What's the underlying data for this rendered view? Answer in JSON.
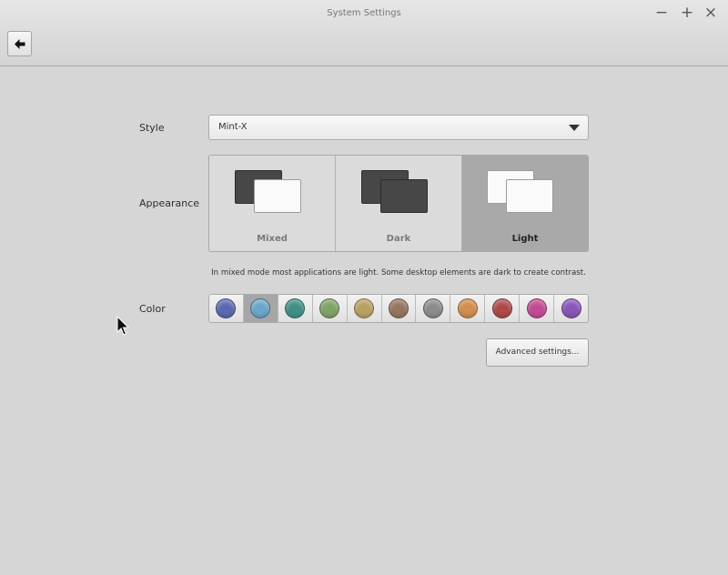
{
  "window": {
    "title": "System Settings",
    "minimize": "−",
    "maximize": "+",
    "close": "×"
  },
  "style": {
    "label": "Style",
    "value": "Mint-X"
  },
  "appearance": {
    "label": "Appearance",
    "options": [
      {
        "label": "Mixed",
        "selected": false
      },
      {
        "label": "Dark",
        "selected": false
      },
      {
        "label": "Light",
        "selected": true
      }
    ],
    "description": "In mixed mode most applications are light. Some desktop elements are dark to create contrast."
  },
  "color": {
    "label": "Color",
    "swatches": [
      {
        "name": "blue",
        "hex": "#5a68b0",
        "selected": false
      },
      {
        "name": "aqua",
        "hex": "#6aa6c8",
        "selected": true
      },
      {
        "name": "teal",
        "hex": "#3f8f85",
        "selected": false
      },
      {
        "name": "green",
        "hex": "#7fa266",
        "selected": false
      },
      {
        "name": "sand",
        "hex": "#b9a060",
        "selected": false
      },
      {
        "name": "brown",
        "hex": "#957460",
        "selected": false
      },
      {
        "name": "grey",
        "hex": "#8b8b8b",
        "selected": false
      },
      {
        "name": "orange",
        "hex": "#d08d4d",
        "selected": false
      },
      {
        "name": "red",
        "hex": "#ad4848",
        "selected": false
      },
      {
        "name": "pink",
        "hex": "#c24a92",
        "selected": false
      },
      {
        "name": "purple",
        "hex": "#8a55b7",
        "selected": false
      }
    ]
  },
  "advanced_button": "Advanced settings..."
}
